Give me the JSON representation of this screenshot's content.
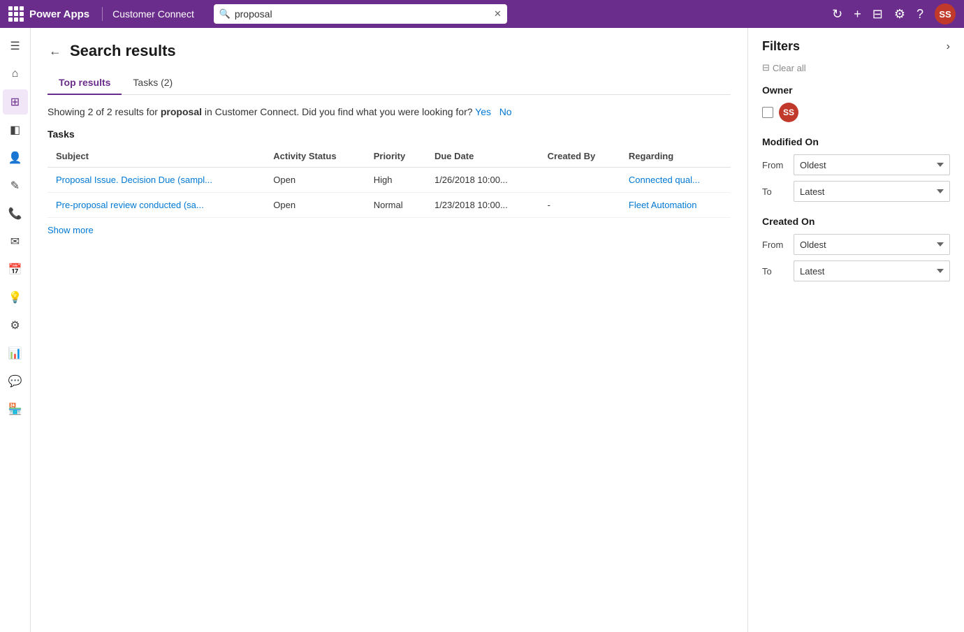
{
  "topbar": {
    "app_name": "Power Apps",
    "app_env": "Customer Connect",
    "search_value": "proposal",
    "search_placeholder": "proposal",
    "avatar_initials": "SS"
  },
  "sidebar": {
    "items": [
      {
        "id": "menu",
        "icon": "☰",
        "label": "menu-icon"
      },
      {
        "id": "home",
        "icon": "⌂",
        "label": "home-icon"
      },
      {
        "id": "dashboard",
        "icon": "⊞",
        "label": "dashboard-icon",
        "active": true
      },
      {
        "id": "records",
        "icon": "◧",
        "label": "records-icon"
      },
      {
        "id": "contacts",
        "icon": "👤",
        "label": "contacts-icon"
      },
      {
        "id": "tasks",
        "icon": "✎",
        "label": "tasks-icon"
      },
      {
        "id": "phone",
        "icon": "📞",
        "label": "phone-icon"
      },
      {
        "id": "email",
        "icon": "✉",
        "label": "email-icon"
      },
      {
        "id": "calendar",
        "icon": "📅",
        "label": "calendar-icon"
      },
      {
        "id": "ideas",
        "icon": "💡",
        "label": "ideas-icon"
      },
      {
        "id": "groups",
        "icon": "⚙",
        "label": "groups-icon"
      },
      {
        "id": "reports",
        "icon": "📊",
        "label": "reports-icon"
      },
      {
        "id": "chat",
        "icon": "💬",
        "label": "chat-icon"
      },
      {
        "id": "store",
        "icon": "🏪",
        "label": "store-icon"
      }
    ]
  },
  "search_results": {
    "page_title": "Search results",
    "tabs": [
      {
        "id": "top",
        "label": "Top results",
        "active": true
      },
      {
        "id": "tasks",
        "label": "Tasks (2)",
        "active": false
      }
    ],
    "summary": "Showing 2 of 2 results for",
    "keyword": "proposal",
    "summary_rest": " in Customer Connect. Did you find what you were looking for?",
    "yes_label": "Yes",
    "no_label": "No",
    "section_label": "Tasks",
    "table": {
      "columns": [
        "Subject",
        "Activity Status",
        "Priority",
        "Due Date",
        "Created By",
        "Regarding"
      ],
      "rows": [
        {
          "subject": "Proposal Issue. Decision Due (sampl...",
          "subject_link": true,
          "activity_status": "Open",
          "priority": "High",
          "due_date": "1/26/2018 10:00...",
          "created_by": "",
          "regarding": "Connected qual...",
          "regarding_link": true
        },
        {
          "subject": "Pre-proposal review conducted (sa...",
          "subject_link": true,
          "activity_status": "Open",
          "priority": "Normal",
          "due_date": "1/23/2018 10:00...",
          "created_by": "-",
          "regarding": "Fleet Automation",
          "regarding_link": true
        }
      ]
    },
    "show_more_label": "Show more"
  },
  "filters": {
    "title": "Filters",
    "clear_all_label": "Clear all",
    "owner_label": "Owner",
    "owner_avatar_initials": "SS",
    "modified_on_label": "Modified On",
    "modified_from_label": "From",
    "modified_to_label": "To",
    "created_on_label": "Created On",
    "created_from_label": "From",
    "created_to_label": "To",
    "date_options": [
      "Oldest",
      "Latest"
    ],
    "modified_from_value": "Oldest",
    "modified_to_value": "Latest",
    "created_from_value": "Oldest",
    "created_to_value": "Latest"
  }
}
